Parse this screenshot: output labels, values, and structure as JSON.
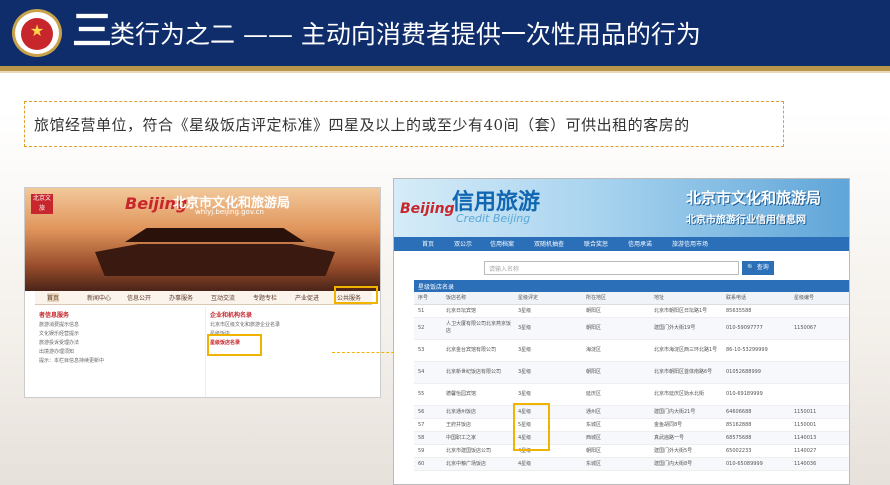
{
  "header": {
    "title_lead": "三",
    "title_rest": "类行为之二 —— 主动向消费者提供一次性用品的行为"
  },
  "criteria": {
    "text": "旅馆经营单位，符合《星级饭店评定标准》四星及以上的或至少有40间（套）可供出租的客房的"
  },
  "left_site": {
    "logo": "北京文旅",
    "brand_word": "Beijing",
    "site_name": "北京市文化和旅游局",
    "site_url": "whlyj.beijing.gov.cn",
    "nav": [
      "首页",
      "新闻中心",
      "信息公开",
      "办事服务",
      "互动交流",
      "专题专栏",
      "产业促进",
      "公共服务"
    ],
    "left_heading": "者信息服务",
    "left_lines": [
      "旅游消费提示信息",
      "文化娱乐经营提示",
      "旅游投诉受理办法",
      "出境游办理须知",
      "提示：本栏目信息持续更新中"
    ],
    "right_heading": "企业和机构名录",
    "right_lines": [
      "北京市区级文化和旅游企业名录",
      "星级饭店",
      "星级饭店名录"
    ]
  },
  "right_site": {
    "brand_word": "Beijing",
    "brand": "信用旅游",
    "brand_sub": "Credit Beijing",
    "title_line1": "北京市文化和旅游局",
    "title_line2": "北京市旅游行业信用信息网",
    "nav": [
      "首页",
      "双公示",
      "信用档案",
      "双随机抽查",
      "联合奖惩",
      "信用承诺",
      "旅游信用市场"
    ],
    "search_placeholder": "请输入名称",
    "search_button": "查询",
    "table_title": "星级饭店名录",
    "columns": [
      "序号",
      "饭店名称",
      "星级评定",
      "所在地区",
      "地址",
      "联系电话",
      "星级编号"
    ],
    "rows": [
      [
        "51",
        "北京日坛宾馆",
        "3星级",
        "朝阳区",
        "北京市朝阳区日坛路1号",
        "85635588",
        ""
      ],
      [
        "52",
        "人卫大厦有限公司北京燕京饭店",
        "3星级",
        "朝阳区",
        "建国门外大街19号",
        "010-59097777",
        "1150067"
      ],
      [
        "53",
        "北京金台宾馆有限公司",
        "3星级",
        "海淀区",
        "北京市海淀区西三环北路1号",
        "86-10-53299999",
        ""
      ],
      [
        "54",
        "北京新世纪饭店有限公司",
        "3星级",
        "朝阳区",
        "北京市朝阳区首体南路6号",
        "01052688999",
        ""
      ],
      [
        "55",
        "德馨怡园宾馆",
        "3星级",
        "延庆区",
        "北京市延庆区妫水北街",
        "010-69189999",
        ""
      ],
      [
        "56",
        "北京通州饭店",
        "4星级",
        "通州区",
        "建国门内大街21号",
        "64606688",
        "1150011"
      ],
      [
        "57",
        "王府井饭店",
        "5星级",
        "东城区",
        "金鱼胡同8号",
        "85162888",
        "1150001"
      ],
      [
        "58",
        "中国职工之家",
        "4星级",
        "西城区",
        "真武庙路一号",
        "68575688",
        "1140013"
      ],
      [
        "59",
        "北京市建国饭店公司",
        "4星级",
        "朝阳区",
        "建国门外大街5号",
        "65002233",
        "1140027"
      ],
      [
        "60",
        "北京中粮广场饭店",
        "4星级",
        "东城区",
        "建国门内大街8号",
        "010-65089999",
        "1140036"
      ]
    ]
  },
  "colors": {
    "header_bg": "#0f2c6b",
    "highlight": "#f0b400",
    "site_blue": "#2a6fb8",
    "accent_red": "#c7262c"
  }
}
